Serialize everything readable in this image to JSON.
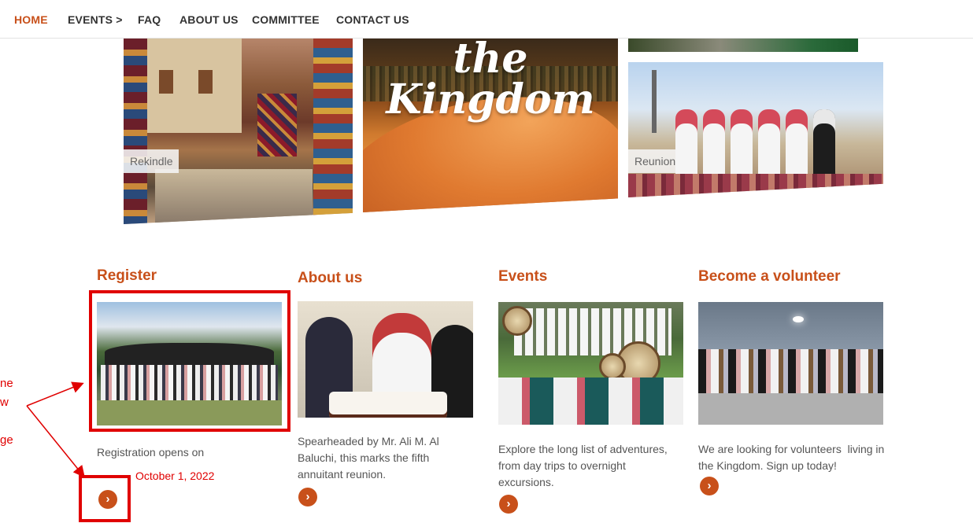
{
  "nav": {
    "items": [
      {
        "label": "HOME",
        "active": true
      },
      {
        "label": "EVENTS >",
        "active": false
      },
      {
        "label": "FAQ",
        "active": false
      },
      {
        "label": "ABOUT US",
        "active": false
      },
      {
        "label": "COMMITTEE",
        "active": false
      },
      {
        "label": "CONTACT US",
        "active": false
      }
    ]
  },
  "hero": {
    "title": "the Kingdom",
    "labels": {
      "left": "Rekindle",
      "right": "Reunion"
    }
  },
  "cards": [
    {
      "title": "Register",
      "text": "Registration opens on",
      "date": "October 1, 2022"
    },
    {
      "title": "About us",
      "text": "Spearheaded by Mr. Ali M. Al Baluchi, this marks the fifth annuitant reunion."
    },
    {
      "title": "Events",
      "text": "Explore the long list of adventures, from day trips to overnight excursions."
    },
    {
      "title": "Become a volunteer",
      "text": "We are looking for volunteers  living in the Kingdom. Sign up today!"
    }
  ],
  "annotation": {
    "lines": [
      "ne",
      "w",
      "",
      "ge"
    ],
    "color": "#e00000"
  },
  "colors": {
    "accent": "#c8501a",
    "annotation": "#e00000",
    "text": "#555555"
  },
  "icons": {
    "card_button": "chevron-right-circle-icon",
    "nav_events": "chevron-right-icon"
  }
}
